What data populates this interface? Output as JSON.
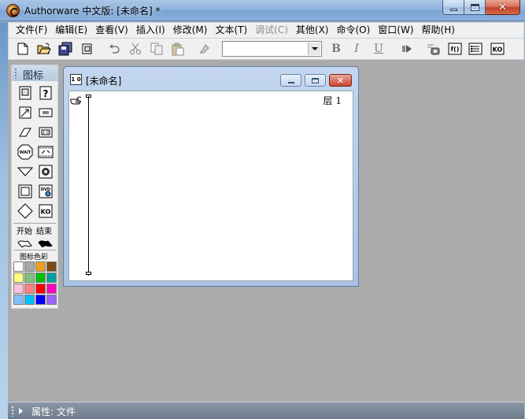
{
  "window": {
    "title": "Authorware 中文版: [未命名] *"
  },
  "menu": [
    {
      "label": "文件(F)",
      "enabled": true
    },
    {
      "label": "编辑(E)",
      "enabled": true
    },
    {
      "label": "查看(V)",
      "enabled": true
    },
    {
      "label": "插入(I)",
      "enabled": true
    },
    {
      "label": "修改(M)",
      "enabled": true
    },
    {
      "label": "文本(T)",
      "enabled": true
    },
    {
      "label": "调试(C)",
      "enabled": false
    },
    {
      "label": "其他(X)",
      "enabled": true
    },
    {
      "label": "命令(O)",
      "enabled": true
    },
    {
      "label": "窗口(W)",
      "enabled": true
    },
    {
      "label": "帮助(H)",
      "enabled": true
    }
  ],
  "toolbar": {
    "buttons": [
      "new-file-icon",
      "open-file-icon",
      "save-all-icon",
      "import-icon",
      "undo-icon",
      "cut-icon",
      "copy-icon",
      "paste-icon",
      "find-icon"
    ],
    "style_combo_value": "",
    "bold_label": "B",
    "italic_label": "I",
    "underline_label": "U",
    "right_buttons": [
      "run-icon",
      "control-panel-icon",
      "functions-icon",
      "variables-icon",
      "knowledge-objects-icon"
    ]
  },
  "palette": {
    "title": "图标",
    "icons": [
      "display-icon",
      "interaction-icon",
      "motion-icon",
      "calculation-icon",
      "erase-icon",
      "map-icon",
      "wait-icon",
      "digital-movie-icon",
      "navigate-icon",
      "sound-icon",
      "framework-icon",
      "video-icon",
      "decision-icon",
      "knowledge-object-icon"
    ],
    "start_label": "开始",
    "end_label": "结束",
    "color_label": "图标色彩",
    "colors": [
      "#ffffff",
      "#a8a8a8",
      "#f0a020",
      "#7a4a1a",
      "#ffff80",
      "#80c080",
      "#00c000",
      "#00a0a0",
      "#ffc0e0",
      "#ff8080",
      "#ff0000",
      "#ff00c0",
      "#80c0ff",
      "#00c0ff",
      "#0000ff",
      "#a060ff"
    ]
  },
  "child_window": {
    "title": "[未命名]",
    "layer_label": "层 1"
  },
  "status": {
    "label": "属性: 文件"
  }
}
